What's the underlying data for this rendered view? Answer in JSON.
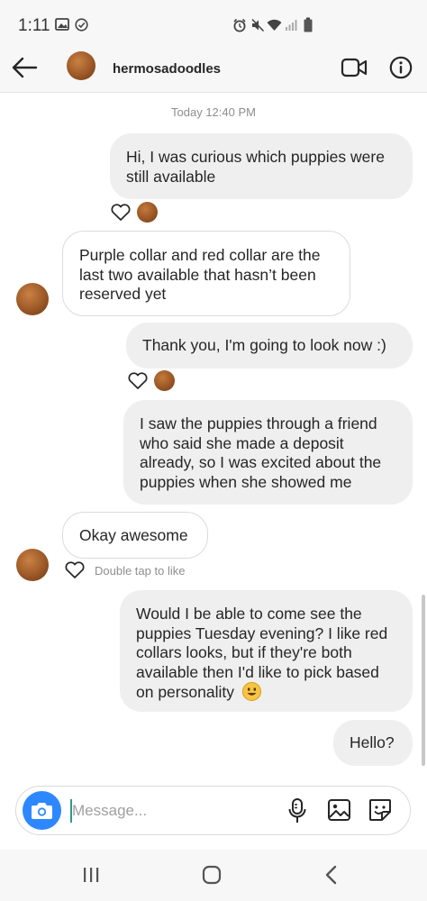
{
  "status_bar": {
    "time": "1:11"
  },
  "header": {
    "username": "hermosadoodles"
  },
  "thread": {
    "timestamp": "Today 12:40 PM",
    "messages": [
      {
        "side": "out",
        "text": "Hi, I was curious which puppies were still available"
      },
      {
        "side": "in",
        "text": "Purple collar and red collar are the last two available that hasn’t been reserved yet"
      },
      {
        "side": "out",
        "text": "Thank you, I'm going to look now :)"
      },
      {
        "side": "out",
        "text": "I saw the puppies through a friend who said she made a deposit already, so I was excited about the puppies when she showed me"
      },
      {
        "side": "in",
        "text": "Okay awesome"
      },
      {
        "side": "out",
        "text": "Would I be able to come see the puppies Tuesday evening?  I like red collars looks, but if they're both available then I'd like to pick based on personality"
      },
      {
        "side": "out",
        "text": "Hello?"
      }
    ],
    "double_tap_hint": "Double tap to like"
  },
  "composer": {
    "placeholder": "Message..."
  },
  "icons": [
    "back-arrow-icon",
    "video-call-icon",
    "info-icon",
    "heart-icon",
    "camera-icon",
    "microphone-icon",
    "gallery-icon",
    "sticker-icon",
    "recent-apps-icon",
    "home-icon",
    "nav-back-icon"
  ],
  "colors": {
    "accent": "#2d88ff",
    "outgoing_bubble": "#efefef",
    "muted_text": "#8e8e8e"
  }
}
